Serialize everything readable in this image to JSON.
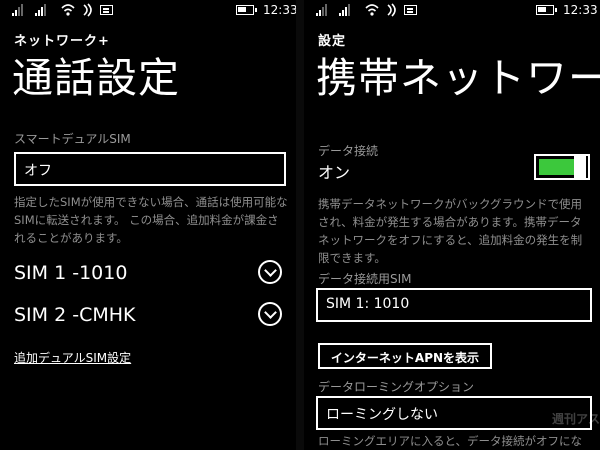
{
  "left_screen": {
    "statusbar": {
      "time": "12:33"
    },
    "app_title": "ネットワーク+",
    "page_title": "通話設定",
    "smart_dual_sim": {
      "label": "スマートデュアルSIM",
      "value": "オフ",
      "help": "指定したSIMが使用できない場合、通話は使用可能なSIMに転送されます。 この場合、追加料金が課金されることがあります。"
    },
    "sims": [
      {
        "label": "SIM 1 -1010"
      },
      {
        "label": "SIM 2 -CMHK"
      }
    ],
    "link": "追加デュアルSIM設定"
  },
  "right_screen": {
    "statusbar": {
      "time": "12:33"
    },
    "app_title": "設定",
    "page_title": "携帯ネットワー",
    "data_connection": {
      "label": "データ接続",
      "state": "オン",
      "on": true,
      "accent_color": "#3cc83c",
      "help": "携帯データネットワークがバックグラウンドで使用され、料金が発生する場合があります。携帯データネットワークをオフにすると、追加料金の発生を制限できます。"
    },
    "data_sim": {
      "label": "データ接続用SIM",
      "value": "SIM 1: 1010"
    },
    "apn_button": "インターネットAPNを表示",
    "roaming": {
      "label": "データローミングオプション",
      "value": "ローミングしない"
    },
    "roaming_help": "ローミングエリアに入ると、データ接続がオフにな",
    "watermark": "週刊アスキー"
  }
}
